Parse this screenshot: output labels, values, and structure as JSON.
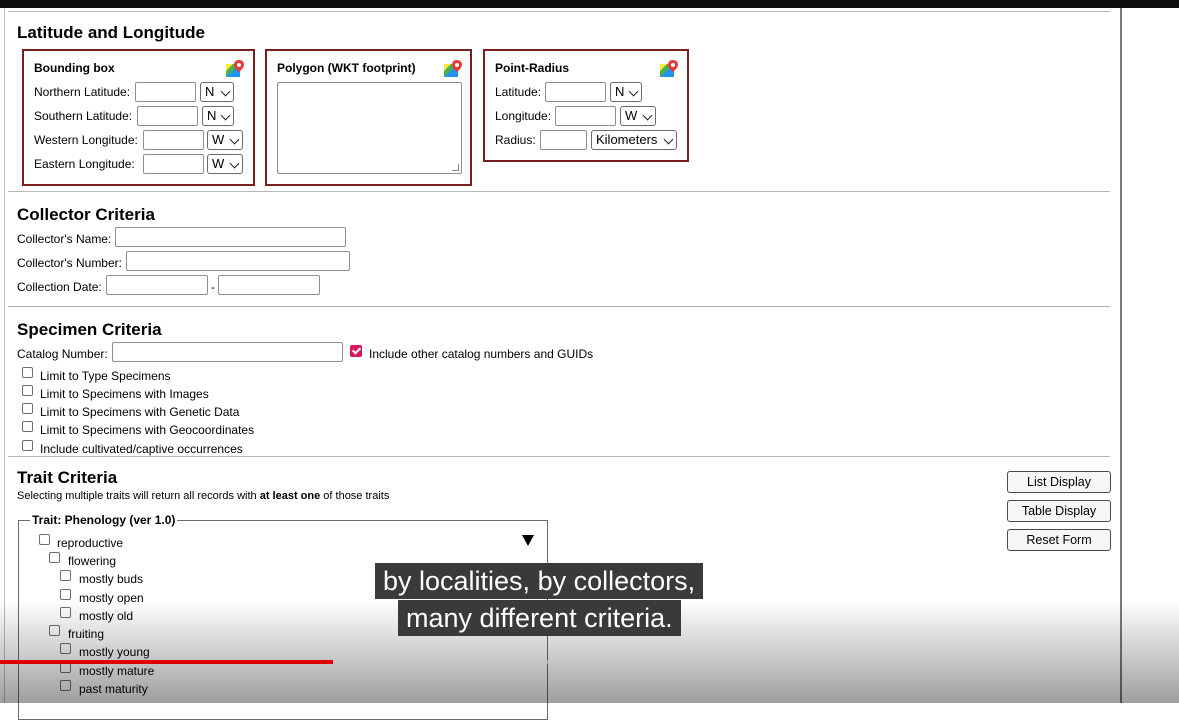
{
  "latlong": {
    "heading": "Latitude and Longitude",
    "bounding_box": {
      "title": "Bounding box",
      "northern_label": "Northern Latitude:",
      "northern_dir": "N",
      "southern_label": "Southern Latitude:",
      "southern_dir": "N",
      "western_label": "Western Longitude:",
      "western_dir": "W",
      "eastern_label": "Eastern Longitude:",
      "eastern_dir": "W"
    },
    "polygon": {
      "title": "Polygon (WKT footprint)"
    },
    "point_radius": {
      "title": "Point-Radius",
      "latitude_label": "Latitude:",
      "latitude_dir": "N",
      "longitude_label": "Longitude:",
      "longitude_dir": "W",
      "radius_label": "Radius:",
      "radius_unit": "Kilometers"
    }
  },
  "collector": {
    "heading": "Collector Criteria",
    "name_label": "Collector's Name:",
    "number_label": "Collector's Number:",
    "date_label": "Collection Date:",
    "date_sep": "-"
  },
  "specimen": {
    "heading": "Specimen Criteria",
    "catalog_label": "Catalog Number:",
    "include_other_label": "Include other catalog numbers and GUIDs",
    "limits": [
      "Limit to Type Specimens",
      "Limit to Specimens with Images",
      "Limit to Specimens with Genetic Data",
      "Limit to Specimens with Geocoordinates",
      "Include cultivated/captive occurrences"
    ]
  },
  "trait": {
    "heading": "Trait Criteria",
    "desc_pre": "Selecting multiple traits will return all records with ",
    "desc_bold": "at least one",
    "desc_post": " of those traits",
    "legend": "Trait: Phenology (ver 1.0)",
    "tree": {
      "reproductive": "reproductive",
      "flowering": "flowering",
      "mostly_buds": "mostly buds",
      "mostly_open": "mostly open",
      "mostly_old": "mostly old",
      "fruiting": "fruiting",
      "mostly_young": "mostly young",
      "mostly_mature": "mostly mature",
      "past_maturity": "past maturity"
    }
  },
  "buttons": {
    "list_display": "List Display",
    "table_display": "Table Display",
    "reset_form": "Reset Form"
  },
  "video": {
    "caption_line1": "by localities, by collectors,",
    "caption_line2": "many different criteria.",
    "progress": 0.378
  },
  "colors": {
    "box_border": "#7a1f1f",
    "checkbox_checked": "#d81b60",
    "progress": "#e00000"
  },
  "icons": [
    "map-pin-icon",
    "dropdown-arrow-icon",
    "checkmark-icon"
  ]
}
